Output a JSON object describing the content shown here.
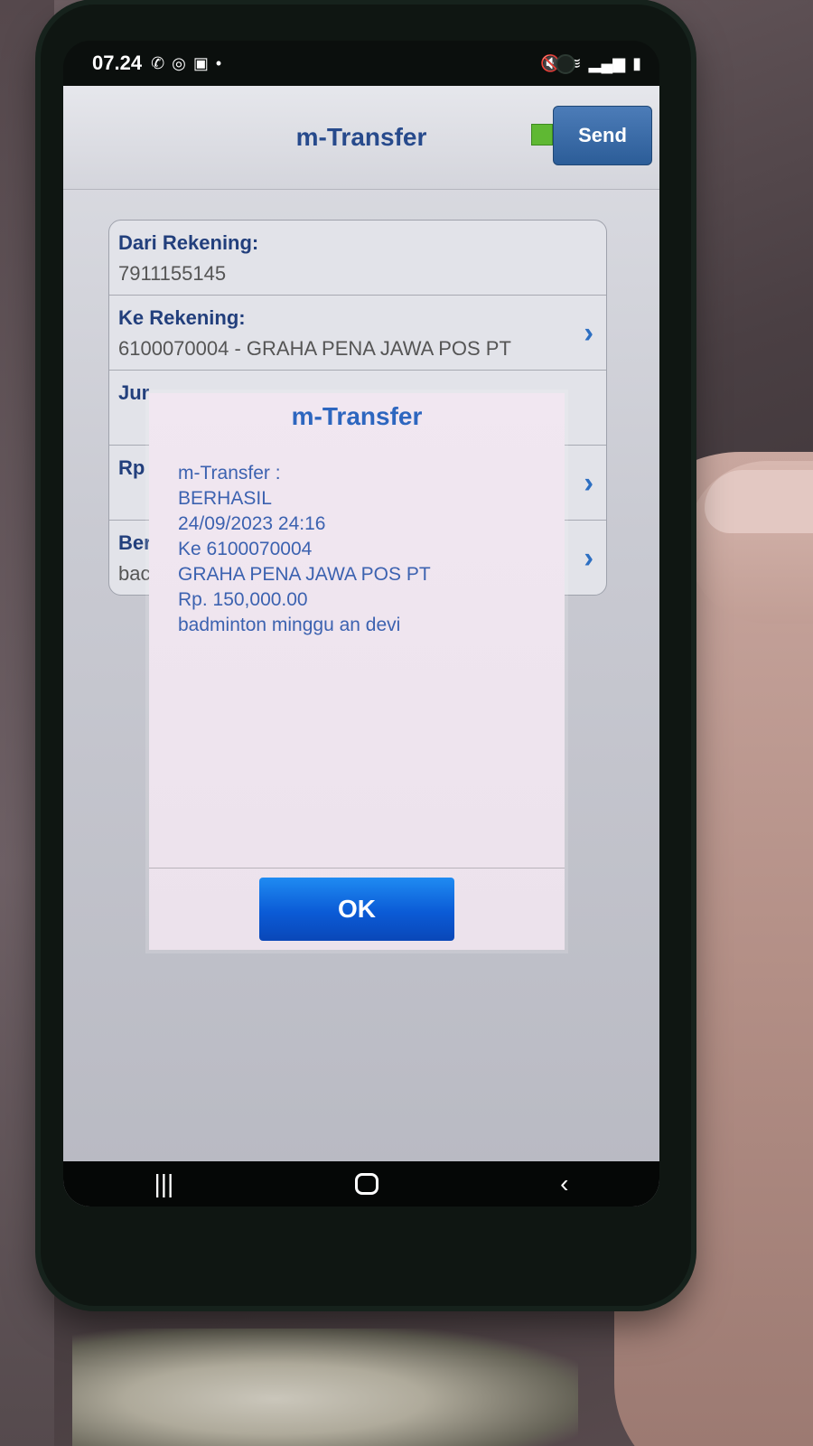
{
  "status_bar": {
    "time": "07.24",
    "icons_left": [
      "whatsapp-icon",
      "instagram-icon",
      "gallery-icon",
      "dot-icon"
    ],
    "icons_right": [
      "mute-icon",
      "wifi-icon",
      "signal-icon",
      "battery-icon"
    ]
  },
  "header": {
    "title": "m-Transfer",
    "send_label": "Send",
    "status_color": "#5fb833"
  },
  "form": {
    "from_label": "Dari Rekening:",
    "from_value": "7911155145",
    "to_label": "Ke Rekening:",
    "to_value": "6100070004 - GRAHA PENA JAWA POS PT",
    "amount_type_label": "Jur",
    "rp_label": "Rp",
    "note_label": "Ber",
    "note_value": "bac"
  },
  "dialog": {
    "title": "m-Transfer",
    "lines": [
      "m-Transfer :",
      "BERHASIL",
      "24/09/2023   24:16",
      "Ke 6100070004",
      "GRAHA PENA JAWA POS PT",
      "Rp. 150,000.00",
      "badminton minggu an devi"
    ],
    "ok_label": "OK"
  },
  "nav_bar": {
    "recents_icon": "|||",
    "back_icon": "‹"
  },
  "colors": {
    "accent_blue": "#2d66bf",
    "ok_button": "#0b5bd6",
    "label_blue": "#223f7c"
  }
}
